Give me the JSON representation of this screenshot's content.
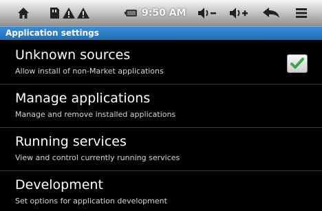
{
  "status_bar": {
    "time": "9:50 AM",
    "icons": [
      "home-icon",
      "sd-card-icon",
      "warning-icon",
      "warning-icon",
      "battery-icon",
      "volume-down-icon",
      "volume-up-icon",
      "back-icon",
      "menu-icon"
    ]
  },
  "title_bar": {
    "title": "Application settings"
  },
  "settings": [
    {
      "title": "Unknown sources",
      "summary": "Allow install of non-Market applications",
      "checked": true
    },
    {
      "title": "Manage applications",
      "summary": "Manage and remove installed applications"
    },
    {
      "title": "Running services",
      "summary": "View and control currently running services"
    },
    {
      "title": "Development",
      "summary": "Set options for application development"
    }
  ],
  "colors": {
    "accent": "#1f6fb8",
    "check": "#3aa84a",
    "background": "#000000"
  }
}
